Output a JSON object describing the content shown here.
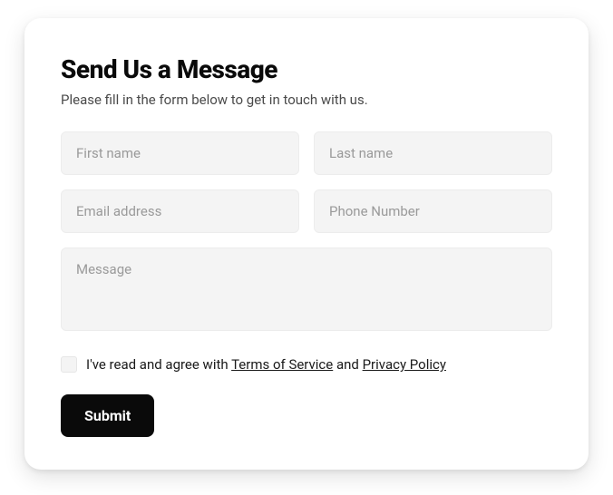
{
  "form": {
    "title": "Send Us a Message",
    "subtitle": "Please fill in the form below to get in touch with us.",
    "fields": {
      "first_name": {
        "placeholder": "First name",
        "value": ""
      },
      "last_name": {
        "placeholder": "Last name",
        "value": ""
      },
      "email": {
        "placeholder": "Email address",
        "value": ""
      },
      "phone": {
        "placeholder": "Phone Number",
        "value": ""
      },
      "message": {
        "placeholder": "Message",
        "value": ""
      }
    },
    "agree": {
      "checked": false,
      "prefix": "I've read and agree with ",
      "tos_label": "Terms of Service",
      "mid": " and ",
      "privacy_label": "Privacy Policy"
    },
    "submit_label": "Submit"
  }
}
